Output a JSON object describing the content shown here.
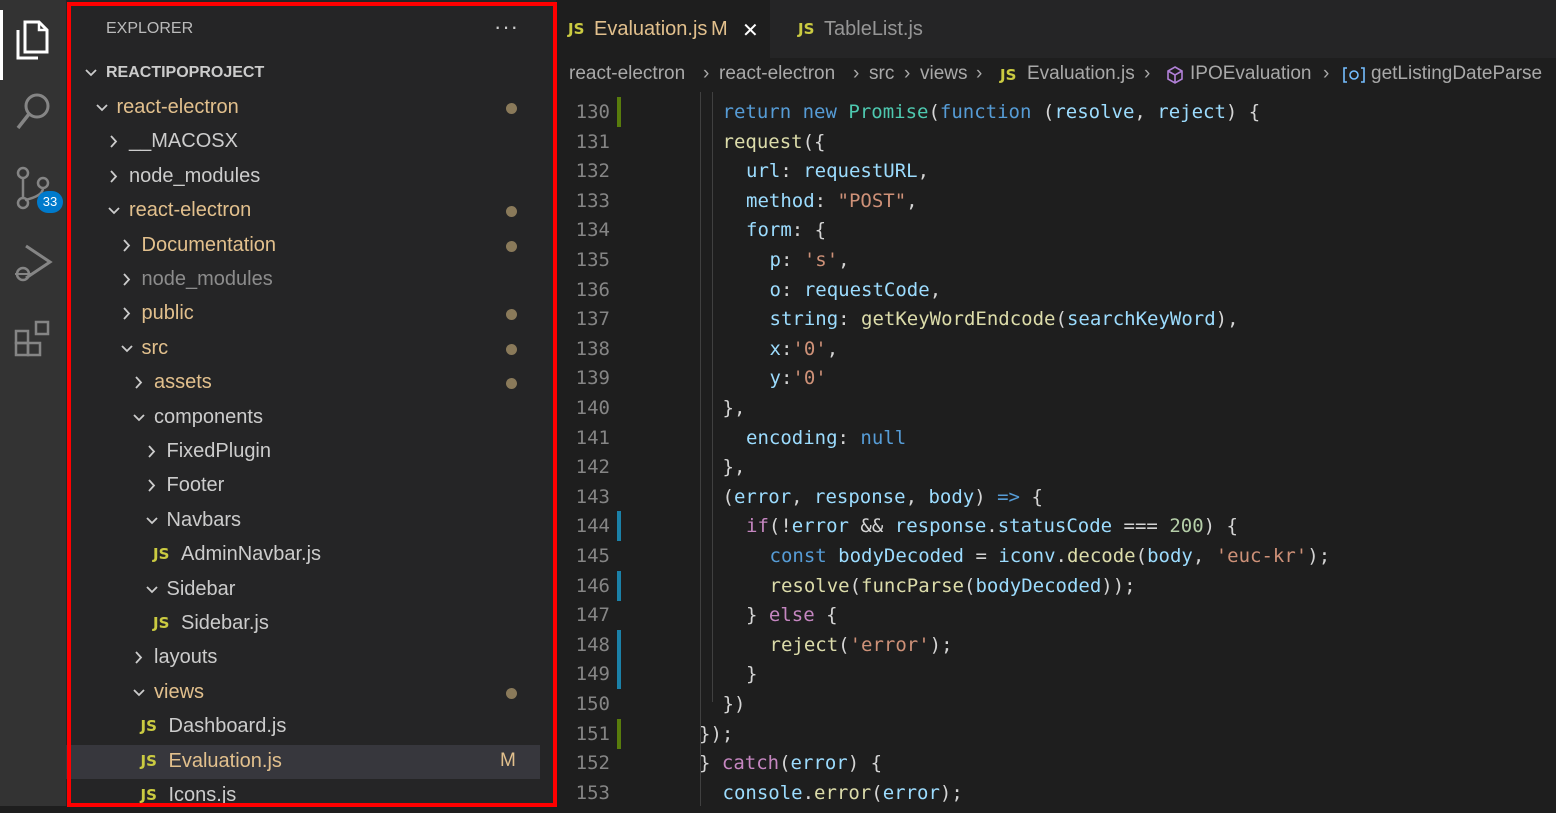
{
  "activity_bar": {
    "items": [
      {
        "icon": "files-icon",
        "active": true
      },
      {
        "icon": "search-icon"
      },
      {
        "icon": "source-control-icon",
        "badge": "33"
      },
      {
        "icon": "run-debug-icon"
      },
      {
        "icon": "extensions-icon"
      }
    ]
  },
  "explorer": {
    "title": "EXPLORER",
    "more": "···",
    "root": "REACTIPOPROJECT",
    "rows": [
      {
        "label": "react-electron",
        "depth": 1,
        "expanded": true,
        "folder": true,
        "status": "modified-dot"
      },
      {
        "label": "__MACOSX",
        "depth": 2,
        "expanded": false,
        "folder": true
      },
      {
        "label": "node_modules",
        "depth": 2,
        "expanded": false,
        "folder": true
      },
      {
        "label": "react-electron",
        "depth": 2,
        "expanded": true,
        "folder": true,
        "status": "modified-dot"
      },
      {
        "label": "Documentation",
        "depth": 3,
        "expanded": false,
        "folder": true,
        "status": "modified-dot"
      },
      {
        "label": "node_modules",
        "depth": 3,
        "expanded": false,
        "folder": true,
        "ignored": true
      },
      {
        "label": "public",
        "depth": 3,
        "expanded": false,
        "folder": true,
        "status": "modified-dot"
      },
      {
        "label": "src",
        "depth": 3,
        "expanded": true,
        "folder": true,
        "status": "modified-dot"
      },
      {
        "label": "assets",
        "depth": 4,
        "expanded": false,
        "folder": true,
        "status": "modified-dot"
      },
      {
        "label": "components",
        "depth": 4,
        "expanded": true,
        "folder": true
      },
      {
        "label": "FixedPlugin",
        "depth": 5,
        "expanded": false,
        "folder": true
      },
      {
        "label": "Footer",
        "depth": 5,
        "expanded": false,
        "folder": true
      },
      {
        "label": "Navbars",
        "depth": 5,
        "expanded": true,
        "folder": true
      },
      {
        "label": "AdminNavbar.js",
        "depth": 6,
        "folder": false
      },
      {
        "label": "Sidebar",
        "depth": 5,
        "expanded": true,
        "folder": true
      },
      {
        "label": "Sidebar.js",
        "depth": 6,
        "folder": false
      },
      {
        "label": "layouts",
        "depth": 4,
        "expanded": false,
        "folder": true
      },
      {
        "label": "views",
        "depth": 4,
        "expanded": true,
        "folder": true,
        "status": "modified-dot"
      },
      {
        "label": "Dashboard.js",
        "depth": 5,
        "folder": false
      },
      {
        "label": "Evaluation.js",
        "depth": 5,
        "folder": false,
        "selected": true,
        "status_text": "M"
      },
      {
        "label": "Icons.js",
        "depth": 5,
        "folder": false
      }
    ]
  },
  "tabs": [
    {
      "file_icon": "JS",
      "name": "Evaluation.js",
      "flag": "M",
      "close": "✕",
      "active": true
    },
    {
      "file_icon": "JS",
      "name": "TableList.js",
      "active": false
    }
  ],
  "breadcrumbs": [
    {
      "text": "react-electron"
    },
    {
      "text": "react-electron"
    },
    {
      "text": "src"
    },
    {
      "text": "views"
    },
    {
      "text": "Evaluation.js",
      "icon": "JS"
    },
    {
      "text": "IPOEvaluation",
      "icon": "cube"
    },
    {
      "text": "getListingDateParse",
      "icon": "method"
    }
  ],
  "editor": {
    "lines": [
      {
        "n": "130",
        "mark": "#587c0c",
        "indent": 1,
        "tokens": [
          [
            "k",
            "return"
          ],
          [
            "p",
            " "
          ],
          [
            "k",
            "new"
          ],
          [
            "p",
            " "
          ],
          [
            "t",
            "Promise"
          ],
          [
            "p",
            "("
          ],
          [
            "k",
            "function"
          ],
          [
            "p",
            " ("
          ],
          [
            "v",
            "resolve"
          ],
          [
            "p",
            ", "
          ],
          [
            "v",
            "reject"
          ],
          [
            "p",
            ") {"
          ]
        ]
      },
      {
        "n": "131",
        "indent": 1,
        "tokens": [
          [
            "f",
            "request"
          ],
          [
            "p",
            "({"
          ]
        ]
      },
      {
        "n": "132",
        "indent": 2,
        "tokens": [
          [
            "v",
            "url"
          ],
          [
            "p",
            ": "
          ],
          [
            "v",
            "requestURL"
          ],
          [
            "p",
            ","
          ]
        ]
      },
      {
        "n": "133",
        "indent": 2,
        "tokens": [
          [
            "v",
            "method"
          ],
          [
            "p",
            ": "
          ],
          [
            "s",
            "\"POST\""
          ],
          [
            "p",
            ","
          ]
        ]
      },
      {
        "n": "134",
        "indent": 2,
        "tokens": [
          [
            "v",
            "form"
          ],
          [
            "p",
            ": {"
          ]
        ]
      },
      {
        "n": "135",
        "indent": 3,
        "tokens": [
          [
            "v",
            "p"
          ],
          [
            "p",
            ": "
          ],
          [
            "s",
            "'s'"
          ],
          [
            "p",
            ","
          ]
        ]
      },
      {
        "n": "136",
        "indent": 3,
        "tokens": [
          [
            "v",
            "o"
          ],
          [
            "p",
            ": "
          ],
          [
            "v",
            "requestCode"
          ],
          [
            "p",
            ","
          ]
        ]
      },
      {
        "n": "137",
        "indent": 3,
        "tokens": [
          [
            "v",
            "string"
          ],
          [
            "p",
            ": "
          ],
          [
            "f",
            "getKeyWordEndcode"
          ],
          [
            "p",
            "("
          ],
          [
            "v",
            "searchKeyWord"
          ],
          [
            "p",
            "),"
          ]
        ]
      },
      {
        "n": "138",
        "indent": 3,
        "tokens": [
          [
            "v",
            "x"
          ],
          [
            "p",
            ":"
          ],
          [
            "s",
            "'0'"
          ],
          [
            "p",
            ","
          ]
        ]
      },
      {
        "n": "139",
        "indent": 3,
        "tokens": [
          [
            "v",
            "y"
          ],
          [
            "p",
            ":"
          ],
          [
            "s",
            "'0'"
          ]
        ]
      },
      {
        "n": "140",
        "indent": 1,
        "tokens": [
          [
            "p",
            "},"
          ]
        ]
      },
      {
        "n": "141",
        "indent": 2,
        "tokens": [
          [
            "v",
            "encoding"
          ],
          [
            "p",
            ": "
          ],
          [
            "k",
            "null"
          ]
        ]
      },
      {
        "n": "142",
        "indent": 1,
        "tokens": [
          [
            "p",
            "},"
          ]
        ]
      },
      {
        "n": "143",
        "indent": 1,
        "tokens": [
          [
            "p",
            "("
          ],
          [
            "v",
            "error"
          ],
          [
            "p",
            ", "
          ],
          [
            "v",
            "response"
          ],
          [
            "p",
            ", "
          ],
          [
            "v",
            "body"
          ],
          [
            "p",
            ") "
          ],
          [
            "k",
            "=>"
          ],
          [
            "p",
            " {"
          ]
        ]
      },
      {
        "n": "144",
        "mark": "#1b81a8",
        "indent": 2,
        "tokens": [
          [
            "kc",
            "if"
          ],
          [
            "p",
            "(!"
          ],
          [
            "v",
            "error"
          ],
          [
            "p",
            " && "
          ],
          [
            "v",
            "response"
          ],
          [
            "p",
            "."
          ],
          [
            "v",
            "statusCode"
          ],
          [
            "p",
            " === "
          ],
          [
            "n",
            "200"
          ],
          [
            "p",
            ") {"
          ]
        ]
      },
      {
        "n": "145",
        "indent": 3,
        "tokens": [
          [
            "k",
            "const"
          ],
          [
            "p",
            " "
          ],
          [
            "v",
            "bodyDecoded"
          ],
          [
            "p",
            " = "
          ],
          [
            "v",
            "iconv"
          ],
          [
            "p",
            "."
          ],
          [
            "f",
            "decode"
          ],
          [
            "p",
            "("
          ],
          [
            "v",
            "body"
          ],
          [
            "p",
            ", "
          ],
          [
            "s",
            "'euc-kr'"
          ],
          [
            "p",
            ");"
          ]
        ]
      },
      {
        "n": "146",
        "mark": "#1b81a8",
        "indent": 3,
        "tokens": [
          [
            "f",
            "resolve"
          ],
          [
            "p",
            "("
          ],
          [
            "f",
            "funcParse"
          ],
          [
            "p",
            "("
          ],
          [
            "v",
            "bodyDecoded"
          ],
          [
            "p",
            "));"
          ]
        ]
      },
      {
        "n": "147",
        "indent": 2,
        "tokens": [
          [
            "p",
            "} "
          ],
          [
            "kc",
            "else"
          ],
          [
            "p",
            " {"
          ]
        ]
      },
      {
        "n": "148",
        "mark": "#1b81a8",
        "indent": 3,
        "tokens": [
          [
            "f",
            "reject"
          ],
          [
            "p",
            "("
          ],
          [
            "s",
            "'error'"
          ],
          [
            "p",
            ");"
          ]
        ]
      },
      {
        "n": "149",
        "mark": "#1b81a8",
        "indent": 2,
        "tokens": [
          [
            "p",
            "}"
          ]
        ]
      },
      {
        "n": "150",
        "indent": 1,
        "tokens": [
          [
            "p",
            "})"
          ]
        ]
      },
      {
        "n": "151",
        "mark": "#587c0c",
        "indent": 0,
        "tokens": [
          [
            "p",
            "});"
          ]
        ]
      },
      {
        "n": "152",
        "indent": 0,
        "tokens": [
          [
            "p",
            "} "
          ],
          [
            "kc",
            "catch"
          ],
          [
            "p",
            "("
          ],
          [
            "v",
            "error"
          ],
          [
            "p",
            ") {"
          ]
        ]
      },
      {
        "n": "153",
        "indent": 1,
        "tokens": [
          [
            "v",
            "console"
          ],
          [
            "p",
            "."
          ],
          [
            "f",
            "error"
          ],
          [
            "p",
            "("
          ],
          [
            "v",
            "error"
          ],
          [
            "p",
            ");"
          ]
        ]
      }
    ]
  }
}
